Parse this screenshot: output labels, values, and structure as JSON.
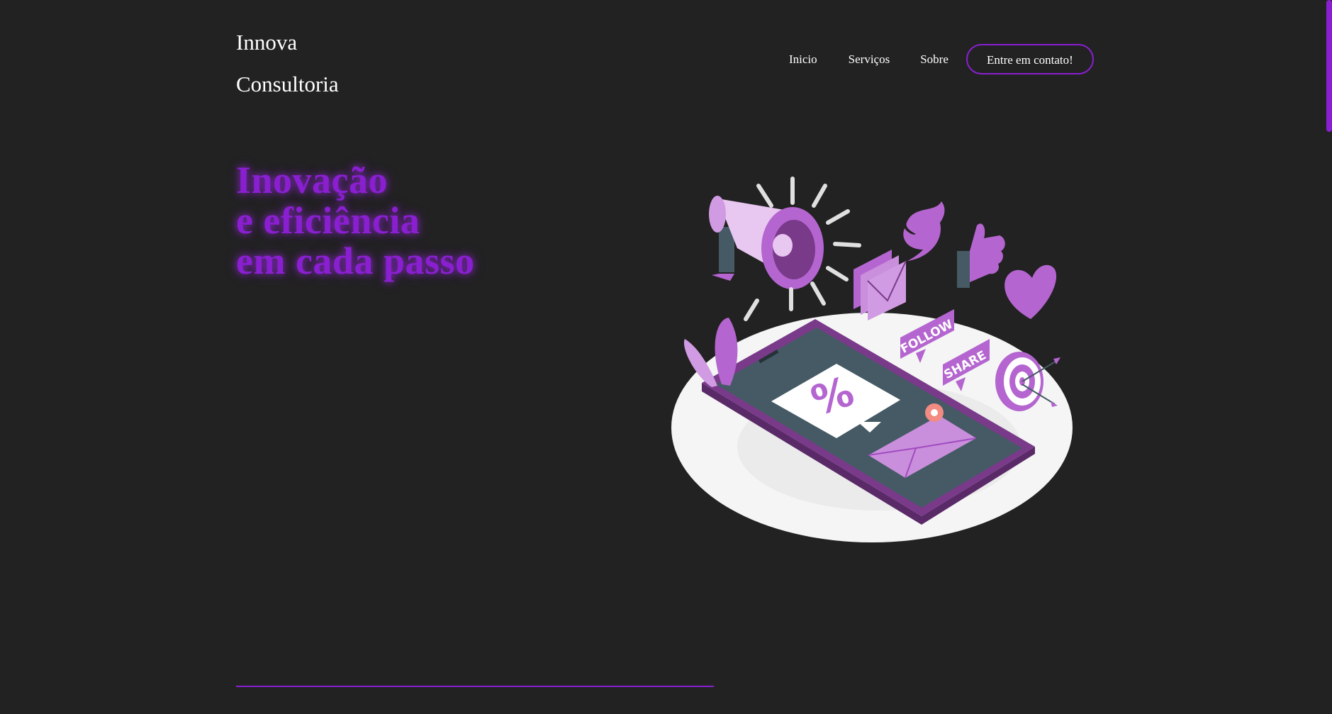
{
  "header": {
    "brand_line1": "Innova",
    "brand_line2": "Consultoria"
  },
  "nav": {
    "items": [
      "Inicio",
      "Serviços",
      "Sobre"
    ],
    "cta_label": "Entre em contato!"
  },
  "hero": {
    "lines": [
      "Inovação",
      "e eficiência",
      "em cada passo"
    ]
  },
  "illustration": {
    "follow_label": "FOLLOW",
    "share_label": "SHARE",
    "percent_label": "%"
  },
  "colors": {
    "background": "#222222",
    "accent": "#8a1fd1",
    "illustration_purple": "#b565d0",
    "phone_screen": "#455a64",
    "platform": "#f5f5f5"
  }
}
